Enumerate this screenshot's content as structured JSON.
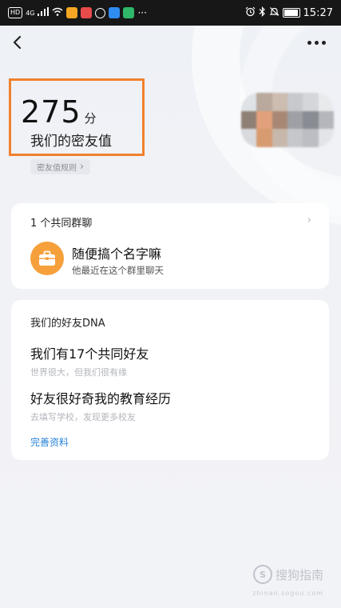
{
  "status_bar": {
    "left_icons": [
      "hd-icon",
      "signal-icon",
      "wifi-icon",
      "app-icon-orange",
      "app-icon-red",
      "app-icon-circle",
      "app-icon-blue",
      "app-icon-green"
    ],
    "overflow": "···",
    "time": "15:27",
    "right_icons": [
      "alarm-icon",
      "bluetooth-icon",
      "mute-icon",
      "battery-icon"
    ],
    "network_label": "4G",
    "hd_label": "HD"
  },
  "header": {
    "back_icon": "chevron-left-icon",
    "more_icon": "more-dots-icon"
  },
  "score": {
    "value": "275",
    "unit": "分",
    "label": "我们的密友值",
    "rules_label": "密友值规则",
    "rules_chevron": "›"
  },
  "common_group": {
    "count_label": "1 个共同群聊",
    "chevron": "›",
    "name": "随便搞个名字嘛",
    "desc": "他最近在这个群里聊天",
    "icon": "briefcase-icon",
    "icon_color": "#f6a03c"
  },
  "dna": {
    "title": "我们的好友DNA",
    "item1_title": "我们有17个共同好友",
    "item1_sub": "世界很大，但我们很有缘",
    "item2_title": "好友很好奇我的教育经历",
    "item2_sub": "去填写学校，发现更多校友",
    "link": "完善资料",
    "link_color": "#2b86d8"
  },
  "watermark": {
    "icon_letter": "S",
    "text": "搜狗指南",
    "sub": "zhinan.sogou.com"
  },
  "colors": {
    "highlight_border": "#f0812e",
    "background": "#f2f3f7"
  }
}
